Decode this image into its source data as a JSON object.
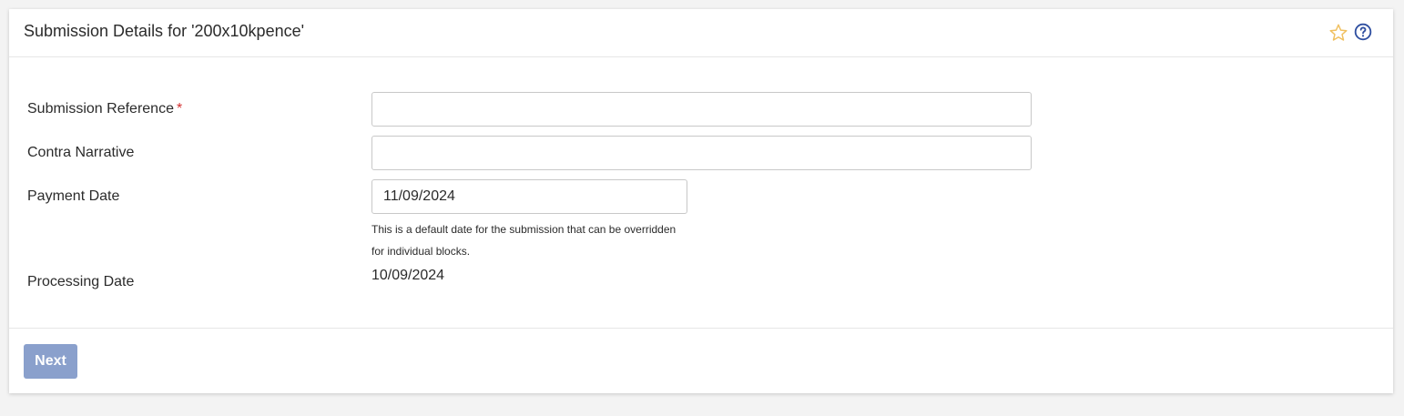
{
  "panel": {
    "title": "Submission Details for '200x10kpence'",
    "icons": {
      "favorite": "star-icon",
      "help": "help-icon",
      "favorite_color": "#f0c060",
      "help_color": "#2f4fa0"
    }
  },
  "form": {
    "submission_reference": {
      "label": "Submission Reference",
      "required_mark": "*",
      "value": "",
      "placeholder": ""
    },
    "contra_narrative": {
      "label": "Contra Narrative",
      "value": "",
      "placeholder": ""
    },
    "payment_date": {
      "label": "Payment Date",
      "value": "11/09/2024",
      "help_text": "This is a default date for the submission that can be overridden for individual blocks."
    },
    "processing_date": {
      "label": "Processing Date",
      "value": "10/09/2024"
    }
  },
  "footer": {
    "next_label": "Next",
    "next_color": "#8aa0cc"
  },
  "colors": {
    "required": "#d32f2f",
    "background": "#f3f3f3"
  }
}
